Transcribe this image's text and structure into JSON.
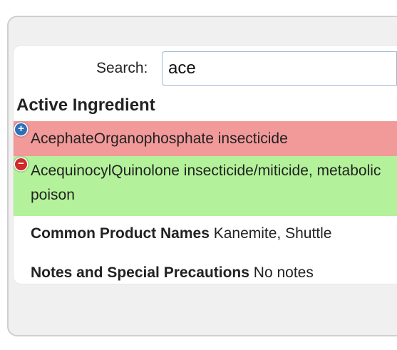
{
  "search": {
    "label": "Search:",
    "value": "ace"
  },
  "table": {
    "header": "Active Ingredient",
    "rows": [
      {
        "name": "Acephate",
        "type": "Organophosphate insecticide",
        "expanded": false,
        "color": "#f29999",
        "icon": "plus-icon"
      },
      {
        "name": "Acequinocyl",
        "type": "Quinolone insecticide/miticide, metabolic poison",
        "expanded": true,
        "color": "#b3f29a",
        "icon": "minus-icon"
      }
    ],
    "details": {
      "product_names_label": "Common Product Names",
      "product_names_value": "Kanemite, Shuttle",
      "notes_label": "Notes and Special Precautions",
      "notes_value": "No notes"
    }
  }
}
